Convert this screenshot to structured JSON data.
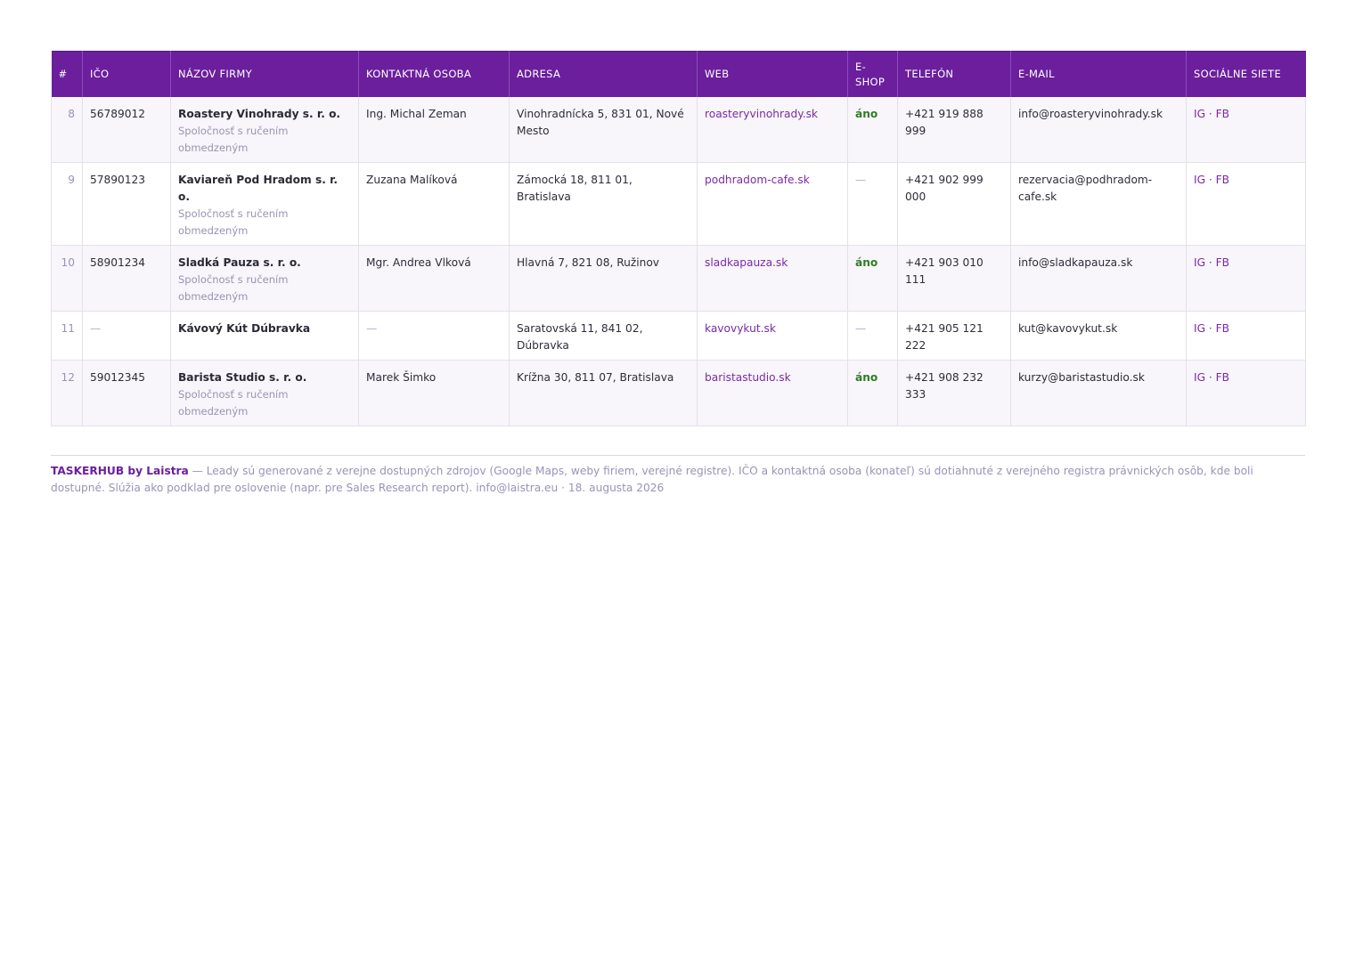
{
  "table": {
    "headers": [
      "#",
      "IČO",
      "Názov firmy",
      "Kontaktná osoba",
      "Adresa",
      "Web",
      "E-shop",
      "Telefón",
      "E-mail",
      "Sociálne siete"
    ],
    "rows": [
      {
        "num": "8",
        "ico": "56789012",
        "name": "Roastery Vinohrady s. r. o.",
        "legal": "Spoločnosť s ručením obmedzeným",
        "contact": "Ing. Michal Zeman",
        "address": "Vinohradnícka 5, 831 01, Nové Mesto",
        "web": "roasteryvinohrady.sk",
        "eshop": "áno",
        "phone": "+421 919 888 999",
        "email": "info@roasteryvinohrady.sk",
        "social": "IG · FB"
      },
      {
        "num": "9",
        "ico": "57890123",
        "name": "Kaviareň Pod Hradom s. r. o.",
        "legal": "Spoločnosť s ručením obmedzeným",
        "contact": "Zuzana Malíková",
        "address": "Zámocká 18, 811 01, Bratislava",
        "web": "podhradom-cafe.sk",
        "eshop": "—",
        "phone": "+421 902 999 000",
        "email": "rezervacia@podhradom-cafe.sk",
        "social": "IG · FB"
      },
      {
        "num": "10",
        "ico": "58901234",
        "name": "Sladká Pauza s. r. o.",
        "legal": "Spoločnosť s ručením obmedzeným",
        "contact": "Mgr. Andrea Vlková",
        "address": "Hlavná 7, 821 08, Ružinov",
        "web": "sladkapauza.sk",
        "eshop": "áno",
        "phone": "+421 903 010 111",
        "email": "info@sladkapauza.sk",
        "social": "IG · FB"
      },
      {
        "num": "11",
        "ico": "—",
        "name": "Kávový Kút Dúbravka",
        "legal": "",
        "contact": "—",
        "address": "Saratovská 11, 841 02, Dúbravka",
        "web": "kavovykut.sk",
        "eshop": "—",
        "phone": "+421 905 121 222",
        "email": "kut@kavovykut.sk",
        "social": "IG · FB"
      },
      {
        "num": "12",
        "ico": "59012345",
        "name": "Barista Studio s. r. o.",
        "legal": "Spoločnosť s ručením obmedzeným",
        "contact": "Marek Šimko",
        "address": "Krížna 30, 811 07, Bratislava",
        "web": "baristastudio.sk",
        "eshop": "áno",
        "phone": "+421 908 232 333",
        "email": "kurzy@baristastudio.sk",
        "social": "IG · FB"
      }
    ]
  },
  "footer": {
    "brand": "TASKERHUB by Laistra",
    "text": " — Leady sú generované z verejne dostupných zdrojov (Google Maps, weby firiem, verejné registre). IČO a kontaktná osoba (konateľ) sú dotiahnuté z verejného registra právnických osôb, kde boli dostupné. Slúžia ako podklad pre oslovenie (napr. pre Sales Research report). info@laistra.eu · 18. augusta 2026"
  },
  "colors": {
    "header_bg": "#6b1f9c",
    "link": "#7a2aa6",
    "yes": "#2f7d22",
    "muted": "#9a93b8"
  }
}
